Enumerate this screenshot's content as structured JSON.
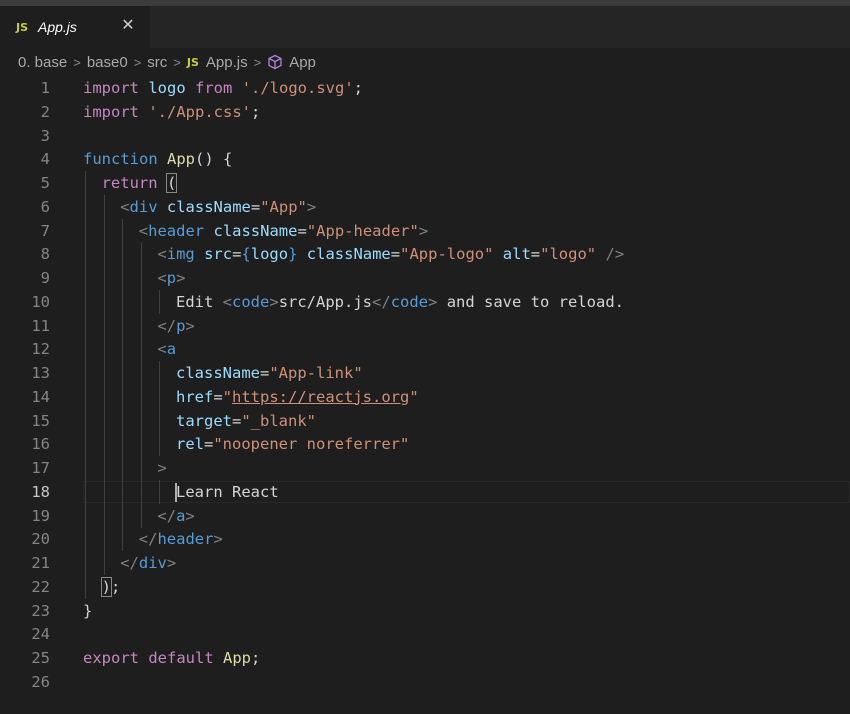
{
  "tab": {
    "badge": "JS",
    "label": "App.js",
    "close": "✕"
  },
  "breadcrumb": {
    "items": [
      "0. base",
      "base0",
      "src"
    ],
    "file_badge": "JS",
    "file": "App.js",
    "symbol": "App"
  },
  "editor": {
    "active_line": 18,
    "lines": [
      {
        "n": "1",
        "indent": 0,
        "tokens": [
          [
            "kw-ctl",
            "import"
          ],
          [
            "pn",
            " "
          ],
          [
            "var",
            "logo"
          ],
          [
            "pn",
            " "
          ],
          [
            "kw-ctl",
            "from"
          ],
          [
            "pn",
            " "
          ],
          [
            "str",
            "'./logo.svg'"
          ],
          [
            "pn",
            ";"
          ]
        ]
      },
      {
        "n": "2",
        "indent": 0,
        "tokens": [
          [
            "kw-ctl",
            "import"
          ],
          [
            "pn",
            " "
          ],
          [
            "str",
            "'./App.css'"
          ],
          [
            "pn",
            ";"
          ]
        ]
      },
      {
        "n": "3",
        "indent": 0,
        "tokens": []
      },
      {
        "n": "4",
        "indent": 0,
        "tokens": [
          [
            "kw",
            "function"
          ],
          [
            "pn",
            " "
          ],
          [
            "fn",
            "App"
          ],
          [
            "pn",
            "() {"
          ]
        ]
      },
      {
        "n": "5",
        "indent": 1,
        "tokens": [
          [
            "kw-ctl",
            "return"
          ],
          [
            "pn",
            " "
          ],
          [
            "pn-bm",
            "("
          ]
        ]
      },
      {
        "n": "6",
        "indent": 2,
        "tokens": [
          [
            "br",
            "<"
          ],
          [
            "tag",
            "div"
          ],
          [
            "pn",
            " "
          ],
          [
            "attr",
            "className"
          ],
          [
            "pn",
            "="
          ],
          [
            "str",
            "\"App\""
          ],
          [
            "br",
            ">"
          ]
        ]
      },
      {
        "n": "7",
        "indent": 3,
        "tokens": [
          [
            "br",
            "<"
          ],
          [
            "tag",
            "header"
          ],
          [
            "pn",
            " "
          ],
          [
            "attr",
            "className"
          ],
          [
            "pn",
            "="
          ],
          [
            "str",
            "\"App-header\""
          ],
          [
            "br",
            ">"
          ]
        ]
      },
      {
        "n": "8",
        "indent": 4,
        "tokens": [
          [
            "br",
            "<"
          ],
          [
            "tag",
            "img"
          ],
          [
            "pn",
            " "
          ],
          [
            "attr",
            "src"
          ],
          [
            "pn",
            "="
          ],
          [
            "jsx",
            "{"
          ],
          [
            "var",
            "logo"
          ],
          [
            "jsx",
            "}"
          ],
          [
            "pn",
            " "
          ],
          [
            "attr",
            "className"
          ],
          [
            "pn",
            "="
          ],
          [
            "str",
            "\"App-logo\""
          ],
          [
            "pn",
            " "
          ],
          [
            "attr",
            "alt"
          ],
          [
            "pn",
            "="
          ],
          [
            "str",
            "\"logo\""
          ],
          [
            "pn",
            " "
          ],
          [
            "br",
            "/>"
          ]
        ]
      },
      {
        "n": "9",
        "indent": 4,
        "tokens": [
          [
            "br",
            "<"
          ],
          [
            "tag",
            "p"
          ],
          [
            "br",
            ">"
          ]
        ]
      },
      {
        "n": "10",
        "indent": 5,
        "tokens": [
          [
            "txt",
            "Edit "
          ],
          [
            "br",
            "<"
          ],
          [
            "tag",
            "code"
          ],
          [
            "br",
            ">"
          ],
          [
            "txt",
            "src/App.js"
          ],
          [
            "br",
            "</"
          ],
          [
            "tag",
            "code"
          ],
          [
            "br",
            ">"
          ],
          [
            "txt",
            " and save to reload."
          ]
        ]
      },
      {
        "n": "11",
        "indent": 4,
        "tokens": [
          [
            "br",
            "</"
          ],
          [
            "tag",
            "p"
          ],
          [
            "br",
            ">"
          ]
        ]
      },
      {
        "n": "12",
        "indent": 4,
        "tokens": [
          [
            "br",
            "<"
          ],
          [
            "tag",
            "a"
          ]
        ]
      },
      {
        "n": "13",
        "indent": 5,
        "tokens": [
          [
            "attr",
            "className"
          ],
          [
            "pn",
            "="
          ],
          [
            "str",
            "\"App-link\""
          ]
        ]
      },
      {
        "n": "14",
        "indent": 5,
        "tokens": [
          [
            "attr",
            "href"
          ],
          [
            "pn",
            "="
          ],
          [
            "str",
            "\""
          ],
          [
            "link",
            "https://reactjs.org"
          ],
          [
            "str",
            "\""
          ]
        ]
      },
      {
        "n": "15",
        "indent": 5,
        "tokens": [
          [
            "attr",
            "target"
          ],
          [
            "pn",
            "="
          ],
          [
            "str",
            "\"_blank\""
          ]
        ]
      },
      {
        "n": "16",
        "indent": 5,
        "tokens": [
          [
            "attr",
            "rel"
          ],
          [
            "pn",
            "="
          ],
          [
            "str",
            "\"noopener noreferrer\""
          ]
        ]
      },
      {
        "n": "17",
        "indent": 4,
        "tokens": [
          [
            "br",
            ">"
          ]
        ]
      },
      {
        "n": "18",
        "indent": 5,
        "tokens": [
          [
            "txt",
            "Learn React"
          ]
        ]
      },
      {
        "n": "19",
        "indent": 4,
        "tokens": [
          [
            "br",
            "</"
          ],
          [
            "tag",
            "a"
          ],
          [
            "br",
            ">"
          ]
        ]
      },
      {
        "n": "20",
        "indent": 3,
        "tokens": [
          [
            "br",
            "</"
          ],
          [
            "tag",
            "header"
          ],
          [
            "br",
            ">"
          ]
        ]
      },
      {
        "n": "21",
        "indent": 2,
        "tokens": [
          [
            "br",
            "</"
          ],
          [
            "tag",
            "div"
          ],
          [
            "br",
            ">"
          ]
        ]
      },
      {
        "n": "22",
        "indent": 1,
        "tokens": [
          [
            "pn-bm",
            ")"
          ],
          [
            "pn",
            ";"
          ]
        ]
      },
      {
        "n": "23",
        "indent": 0,
        "tokens": [
          [
            "pn",
            "}"
          ]
        ]
      },
      {
        "n": "24",
        "indent": 0,
        "tokens": []
      },
      {
        "n": "25",
        "indent": 0,
        "tokens": [
          [
            "kw-ctl",
            "export"
          ],
          [
            "pn",
            " "
          ],
          [
            "kw-ctl",
            "default"
          ],
          [
            "pn",
            " "
          ],
          [
            "fn",
            "App"
          ],
          [
            "pn",
            ";"
          ]
        ]
      },
      {
        "n": "26",
        "indent": 0,
        "tokens": []
      }
    ]
  },
  "colors": {
    "background": "#1e1e1e",
    "tab_strip": "#252526",
    "keyword": "#569cd6",
    "control_keyword": "#c586c0",
    "string": "#ce9178",
    "variable": "#9cdcfe",
    "function": "#dcdcaa",
    "js_badge": "#cbcb41"
  }
}
